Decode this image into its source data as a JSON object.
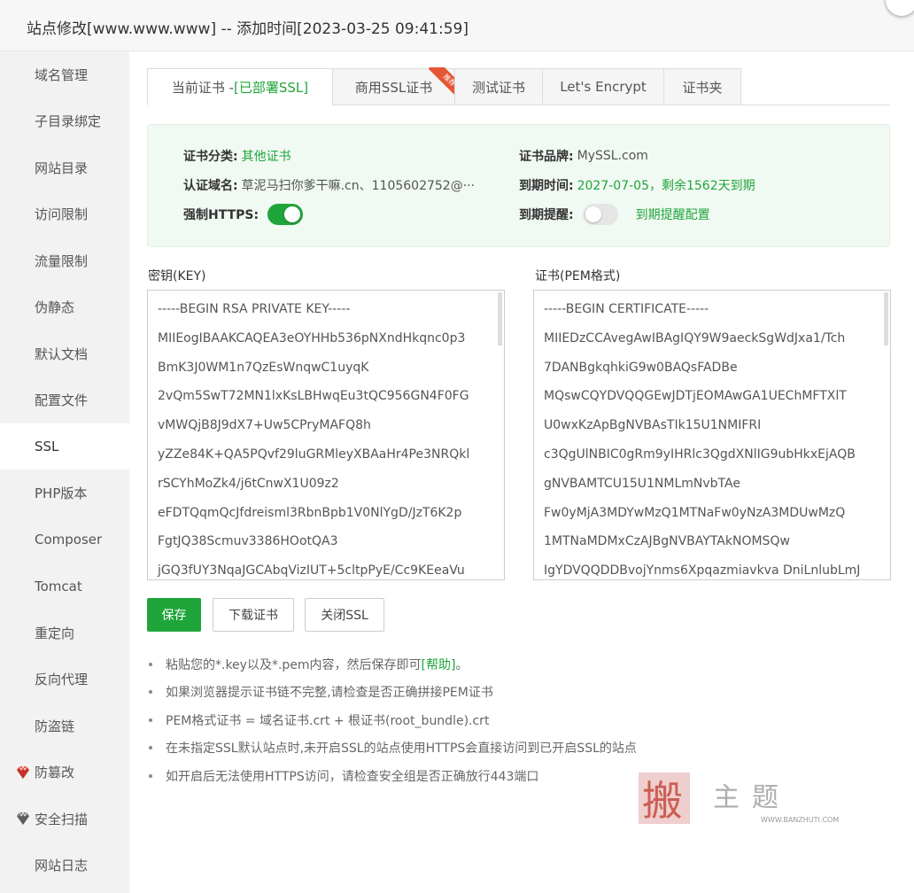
{
  "window": {
    "title": "站点修改[www.www.www] -- 添加时间[2023-03-25 09:41:59]"
  },
  "sidebar": {
    "items": [
      {
        "label": "域名管理"
      },
      {
        "label": "子目录绑定"
      },
      {
        "label": "网站目录"
      },
      {
        "label": "访问限制"
      },
      {
        "label": "流量限制"
      },
      {
        "label": "伪静态"
      },
      {
        "label": "默认文档"
      },
      {
        "label": "配置文件"
      },
      {
        "label": "SSL"
      },
      {
        "label": "PHP版本"
      },
      {
        "label": "Composer"
      },
      {
        "label": "Tomcat"
      },
      {
        "label": "重定向"
      },
      {
        "label": "反向代理"
      },
      {
        "label": "防盗链"
      },
      {
        "label": "防篡改",
        "icon": "red-gem-icon"
      },
      {
        "label": "安全扫描",
        "icon": "gray-gem-icon"
      },
      {
        "label": "网站日志"
      }
    ],
    "active": "SSL"
  },
  "tabs": [
    {
      "label": "当前证书 - ",
      "status": "[已部署SSL]"
    },
    {
      "label": "商用SSL证书",
      "badge": "推荐"
    },
    {
      "label": "测试证书"
    },
    {
      "label": "Let's Encrypt"
    },
    {
      "label": "证书夹"
    }
  ],
  "cert_info": {
    "category_label": "证书分类:",
    "category_value": "其他证书",
    "brand_label": "证书品牌:",
    "brand_value": "MySSL.com",
    "domain_label": "认证域名:",
    "domain_value": "草泥马扫你爹干嘛.cn、1105602752@···",
    "expire_label": "到期时间:",
    "expire_value": "2027-07-05，剩余1562天到期",
    "https_label": "强制HTTPS:",
    "https_on": true,
    "remind_label": "到期提醒:",
    "remind_on": false,
    "remind_link": "到期提醒配置"
  },
  "key": {
    "label": "密钥(KEY)",
    "lines": [
      "-----BEGIN RSA PRIVATE KEY-----",
      "MIIEogIBAAKCAQEA3eOYHHb536pNXndHkqnc0p3",
      "BmK3J0WM1n7QzEsWnqwC1uyqK",
      "2vQm5SwT72MN1lxKsLBHwqEu3tQC956GN4F0FG",
      "vMWQjB8J9dX7+Uw5CPryMAFQ8h",
      "yZZe84K+QA5PQvf29luGRMleyXBAaHr4Pe3NRQkl",
      "rSCYhMoZk4/j6tCnwX1U09z2",
      "eFDTQqmQcJfdreisml3RbnBpb1V0NlYgD/JzT6K2p",
      "FgtJQ38Scmuv3386HOotQA3",
      "jGQ3fUY3NqaJGCAbqVizIUT+5cltpPyE/Cc9KEeaVu"
    ]
  },
  "cert": {
    "label": "证书(PEM格式)",
    "lines": [
      "-----BEGIN CERTIFICATE-----",
      "MIIEDzCCAvegAwIBAgIQY9W9aeckSgWdJxa1/Tch",
      "7DANBgkqhkiG9w0BAQsFADBe",
      "MQswCQYDVQQGEwJDTjEOMAwGA1UEChMFTXlT",
      "U0wxKzApBgNVBAsTIk15U1NMIFRI",
      "c3QgUlNBIC0gRm9yIHRlc3QgdXNlIG9ubHkxEjAQB",
      "gNVBAMTCU15U1NMLmNvbTAe",
      "Fw0yMjA3MDYwMzQ1MTNaFw0yNzA3MDUwMzQ",
      "1MTNaMDMxCzAJBgNVBAYTAkNOMSQw",
      "IgYDVQQDDBvojYnms6Xpqazmiavkva DniLnlubLmJ"
    ]
  },
  "buttons": {
    "save": "保存",
    "download": "下载证书",
    "close_ssl": "关闭SSL"
  },
  "tips": {
    "t1_pre": "粘贴您的*.key以及*.pem内容，然后保存即可",
    "t1_help": "[帮助]",
    "t1_post": "。",
    "t2": "如果浏览器提示证书链不完整,请检查是否正确拼接PEM证书",
    "t3": "PEM格式证书 = 域名证书.crt + 根证书(root_bundle).crt",
    "t4": "在未指定SSL默认站点时,未开启SSL的站点使用HTTPS会直接访问到已开启SSL的站点",
    "t5": "如开启后无法使用HTTPS访问，请检查安全组是否正确放行443端口"
  },
  "watermark": {
    "text": "搬主题",
    "url": "WWW.BANZHUTI.COM"
  },
  "colors": {
    "accent": "#20a53a",
    "ribbon": "#e55634"
  }
}
